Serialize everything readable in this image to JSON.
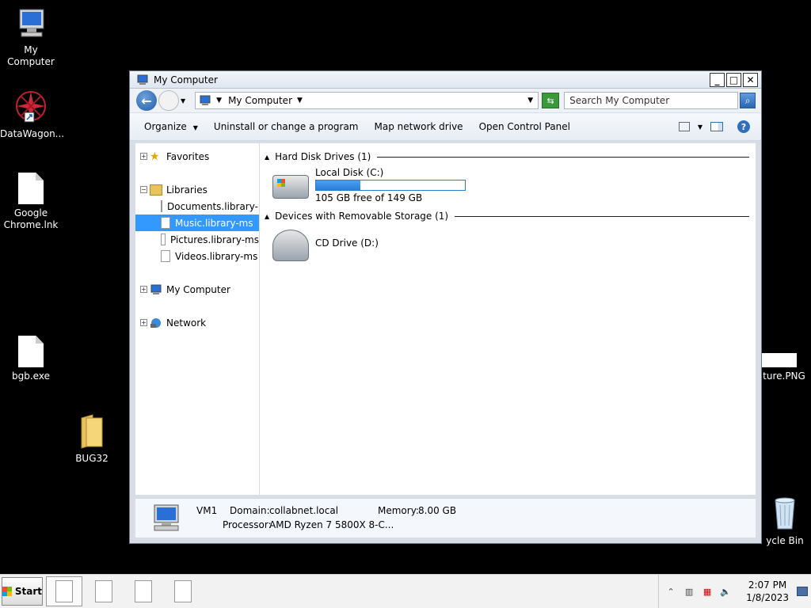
{
  "desktop": {
    "icons": [
      {
        "label": "My Computer"
      },
      {
        "label": "DataWagon..."
      },
      {
        "label": "Google Chrome.lnk"
      },
      {
        "label": "bgb.exe"
      },
      {
        "label": "BUG32"
      },
      {
        "label": "ture.PNG"
      },
      {
        "label": "ycle Bin"
      }
    ]
  },
  "window": {
    "title": "My Computer",
    "address": "My Computer",
    "search_placeholder": "Search My Computer",
    "toolbar": {
      "organize": "Organize",
      "uninstall": "Uninstall or change a program",
      "map_drive": "Map network drive",
      "control_panel": "Open Control Panel"
    },
    "nav": {
      "favorites": "Favorites",
      "libraries": "Libraries",
      "library_items": [
        "Documents.library-ms",
        "Music.library-ms",
        "Pictures.library-ms",
        "Videos.library-ms"
      ],
      "my_computer": "My Computer",
      "network": "Network"
    },
    "groups": {
      "hdd": "Hard Disk Drives (1)",
      "removable": "Devices with Removable Storage (1)"
    },
    "drives": {
      "c_name": "Local Disk (C:)",
      "c_free": "105 GB free of 149 GB",
      "c_used_fraction": 0.2953,
      "d_name": "CD Drive (D:)"
    },
    "details": {
      "name": "VM1",
      "domain_label": "Domain:",
      "domain": "collabnet.local",
      "memory_label": "Memory:",
      "memory": "8.00 GB",
      "processor_label": "Processor:",
      "processor": "AMD Ryzen 7 5800X 8-C..."
    }
  },
  "taskbar": {
    "start": "Start",
    "time": "2:07 PM",
    "date": "1/8/2023"
  }
}
